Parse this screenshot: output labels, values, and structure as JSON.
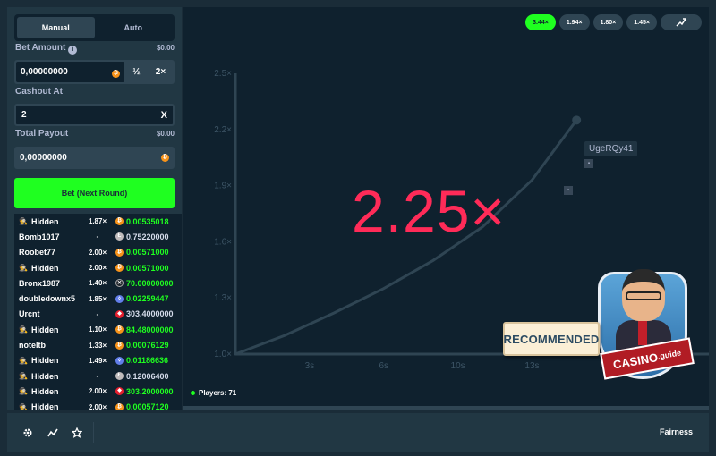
{
  "tabs": [
    {
      "label": "Manual",
      "active": true
    },
    {
      "label": "Auto",
      "active": false
    }
  ],
  "bet": {
    "label": "Bet Amount",
    "fiat": "$0.00",
    "value": "0,00000000",
    "half": "½",
    "double": "2×"
  },
  "cashout": {
    "label": "Cashout At",
    "value": "2",
    "clear": "X"
  },
  "payout": {
    "label": "Total Payout",
    "fiat": "$0.00",
    "value": "0,00000000"
  },
  "bet_button": "Bet (Next Round)",
  "players": [
    {
      "name": "Hidden",
      "hidden": true,
      "mult": "1.87×",
      "payout": "0.00535018",
      "coin": "btc",
      "won": true
    },
    {
      "name": "Bomb1017",
      "hidden": false,
      "mult": "-",
      "payout": "0.75220000",
      "coin": "ltc",
      "won": false
    },
    {
      "name": "Roobet77",
      "hidden": false,
      "mult": "2.00×",
      "payout": "0.00571000",
      "coin": "btc",
      "won": true
    },
    {
      "name": "Hidden",
      "hidden": true,
      "mult": "2.00×",
      "payout": "0.00571000",
      "coin": "btc",
      "won": true
    },
    {
      "name": "Bronx1987",
      "hidden": false,
      "mult": "1.40×",
      "payout": "70.00000000",
      "coin": "xrp",
      "won": true
    },
    {
      "name": "doubledownx5",
      "hidden": false,
      "mult": "1.85×",
      "payout": "0.02259447",
      "coin": "eth",
      "won": true
    },
    {
      "name": "Urcnt",
      "hidden": false,
      "mult": "-",
      "payout": "303.4000000",
      "coin": "trx",
      "won": false
    },
    {
      "name": "Hidden",
      "hidden": true,
      "mult": "1.10×",
      "payout": "84.48000000",
      "coin": "btc",
      "won": true
    },
    {
      "name": "noteltb",
      "hidden": false,
      "mult": "1.33×",
      "payout": "0.00076129",
      "coin": "btc",
      "won": true
    },
    {
      "name": "Hidden",
      "hidden": true,
      "mult": "1.49×",
      "payout": "0.01186636",
      "coin": "eth",
      "won": true
    },
    {
      "name": "Hidden",
      "hidden": true,
      "mult": "-",
      "payout": "0.12006400",
      "coin": "ltc",
      "won": false
    },
    {
      "name": "Hidden",
      "hidden": true,
      "mult": "2.00×",
      "payout": "303.2000000",
      "coin": "trx",
      "won": true
    },
    {
      "name": "Hidden",
      "hidden": true,
      "mult": "2.00×",
      "payout": "0.00057120",
      "coin": "btc",
      "won": true
    }
  ],
  "history": [
    {
      "label": "3.44×",
      "color": "#1fff20"
    },
    {
      "label": "1.94×",
      "color": "#2f4553"
    },
    {
      "label": "1.80×",
      "color": "#2f4553"
    },
    {
      "label": "1.45×",
      "color": "#2f4553"
    }
  ],
  "history_icon": "trend-icon",
  "current_multiplier": "2.25×",
  "overlay_name": "UgeRQy41",
  "players_count": "Players: 71",
  "promo": {
    "banner": "RECOMMENDED",
    "ribbon": "CASINO",
    "ribbon_suffix": ".guide"
  },
  "footer": {
    "icons": [
      "gear-icon",
      "chart-icon",
      "star-icon"
    ],
    "fairness": "Fairness"
  },
  "chart_data": {
    "type": "line",
    "x_ticks": [
      "3s",
      "6s",
      "10s",
      "13s"
    ],
    "y_ticks": [
      "1.0×",
      "1.3×",
      "1.6×",
      "1.9×",
      "2.2×",
      "2.5×"
    ],
    "ylim": [
      1.0,
      2.5
    ],
    "xlim": [
      0,
      14.3
    ],
    "x": [
      0,
      2,
      4,
      6,
      8,
      10,
      12,
      13.8
    ],
    "y": [
      1.0,
      1.1,
      1.22,
      1.35,
      1.5,
      1.68,
      1.93,
      2.25
    ]
  }
}
